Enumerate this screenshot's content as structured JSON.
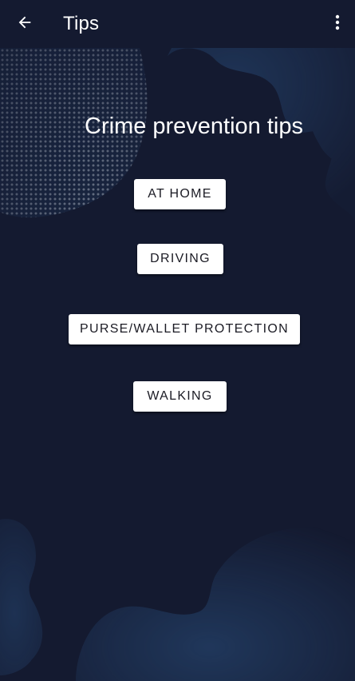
{
  "toolbar": {
    "title": "Tips",
    "back_icon": "arrow-back-icon",
    "menu_icon": "more-vertical-icon"
  },
  "main": {
    "heading": "Crime prevention tips",
    "buttons": [
      {
        "label": "AT HOME"
      },
      {
        "label": "DRIVING"
      },
      {
        "label": "PURSE/WALLET PROTECTION"
      },
      {
        "label": "WALKING"
      }
    ]
  },
  "colors": {
    "background": "#141a30",
    "toolbar": "#141a30",
    "button_bg": "#ffffff",
    "button_text": "#1b1b24",
    "decoration": "#2a4f7e"
  }
}
